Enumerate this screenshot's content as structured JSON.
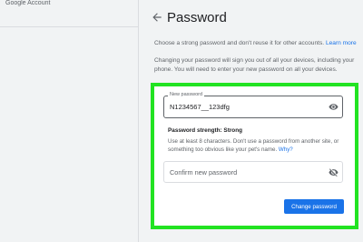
{
  "header": {
    "logo_text": "Google Account",
    "title": "Password"
  },
  "intro": {
    "text": "Choose a strong password and don't reuse it for other accounts.",
    "link": "Learn more"
  },
  "warning": "Changing your password will sign you out of all your devices, including your phone. You will need to enter your new password on all your devices.",
  "new_password": {
    "label": "New password",
    "value": "N1234567__123dfg"
  },
  "strength": {
    "label": "Password strength: Strong",
    "hint": "Use at least 8 characters. Don't use a password from another site, or something too obvious like your pet's name.",
    "hint_link": "Why?"
  },
  "confirm_password": {
    "placeholder": "Confirm new password"
  },
  "actions": {
    "submit_label": "Change password"
  },
  "icons": {
    "back": "arrow-back-icon",
    "show_password": "eye-icon",
    "hide_password": "eye-off-icon"
  },
  "colors": {
    "accent": "#1a73e8",
    "highlight": "#22e322",
    "background": "#f1f3f4"
  }
}
